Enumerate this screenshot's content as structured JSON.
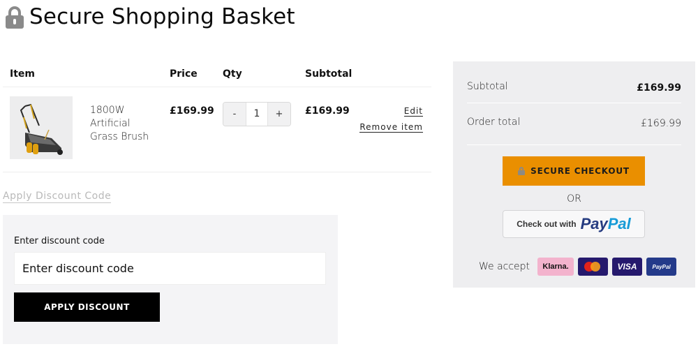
{
  "page": {
    "title": "Secure Shopping Basket",
    "title_icon": "lock-icon"
  },
  "basket": {
    "columns": [
      "Item",
      "Price",
      "Qty",
      "Subtotal"
    ],
    "items": [
      {
        "image_alt": "lawn-scarifier-product-image",
        "name": "1800W Artificial Grass Brush",
        "price": "£169.99",
        "qty": "1",
        "qty_decrement": "-",
        "qty_increment": "+",
        "subtotal": "£169.99",
        "edit_label": "Edit",
        "remove_label": "Remove item"
      }
    ]
  },
  "discount": {
    "toggle_label": "Apply Discount Code",
    "field_label": "Enter discount code",
    "placeholder": "Enter discount code",
    "value": "",
    "apply_label": "APPLY DISCOUNT"
  },
  "summary": {
    "subtotal_label": "Subtotal",
    "subtotal_value": "£169.99",
    "order_total_label": "Order total",
    "order_total_value": "£169.99",
    "checkout_label": "SECURE CHECKOUT",
    "or_label": "OR",
    "paypal_prefix": "Check out with",
    "paypal_brand_a": "Pay",
    "paypal_brand_b": "Pal",
    "accept_label": "We accept",
    "payment_methods": [
      "Klarna.",
      "Maestro",
      "VISA",
      "PayPal"
    ]
  },
  "colors": {
    "checkout": "#ea8f00",
    "apply": "#000000",
    "summary_bg": "#eeeef0",
    "discount_bg": "#f4f4f6"
  }
}
